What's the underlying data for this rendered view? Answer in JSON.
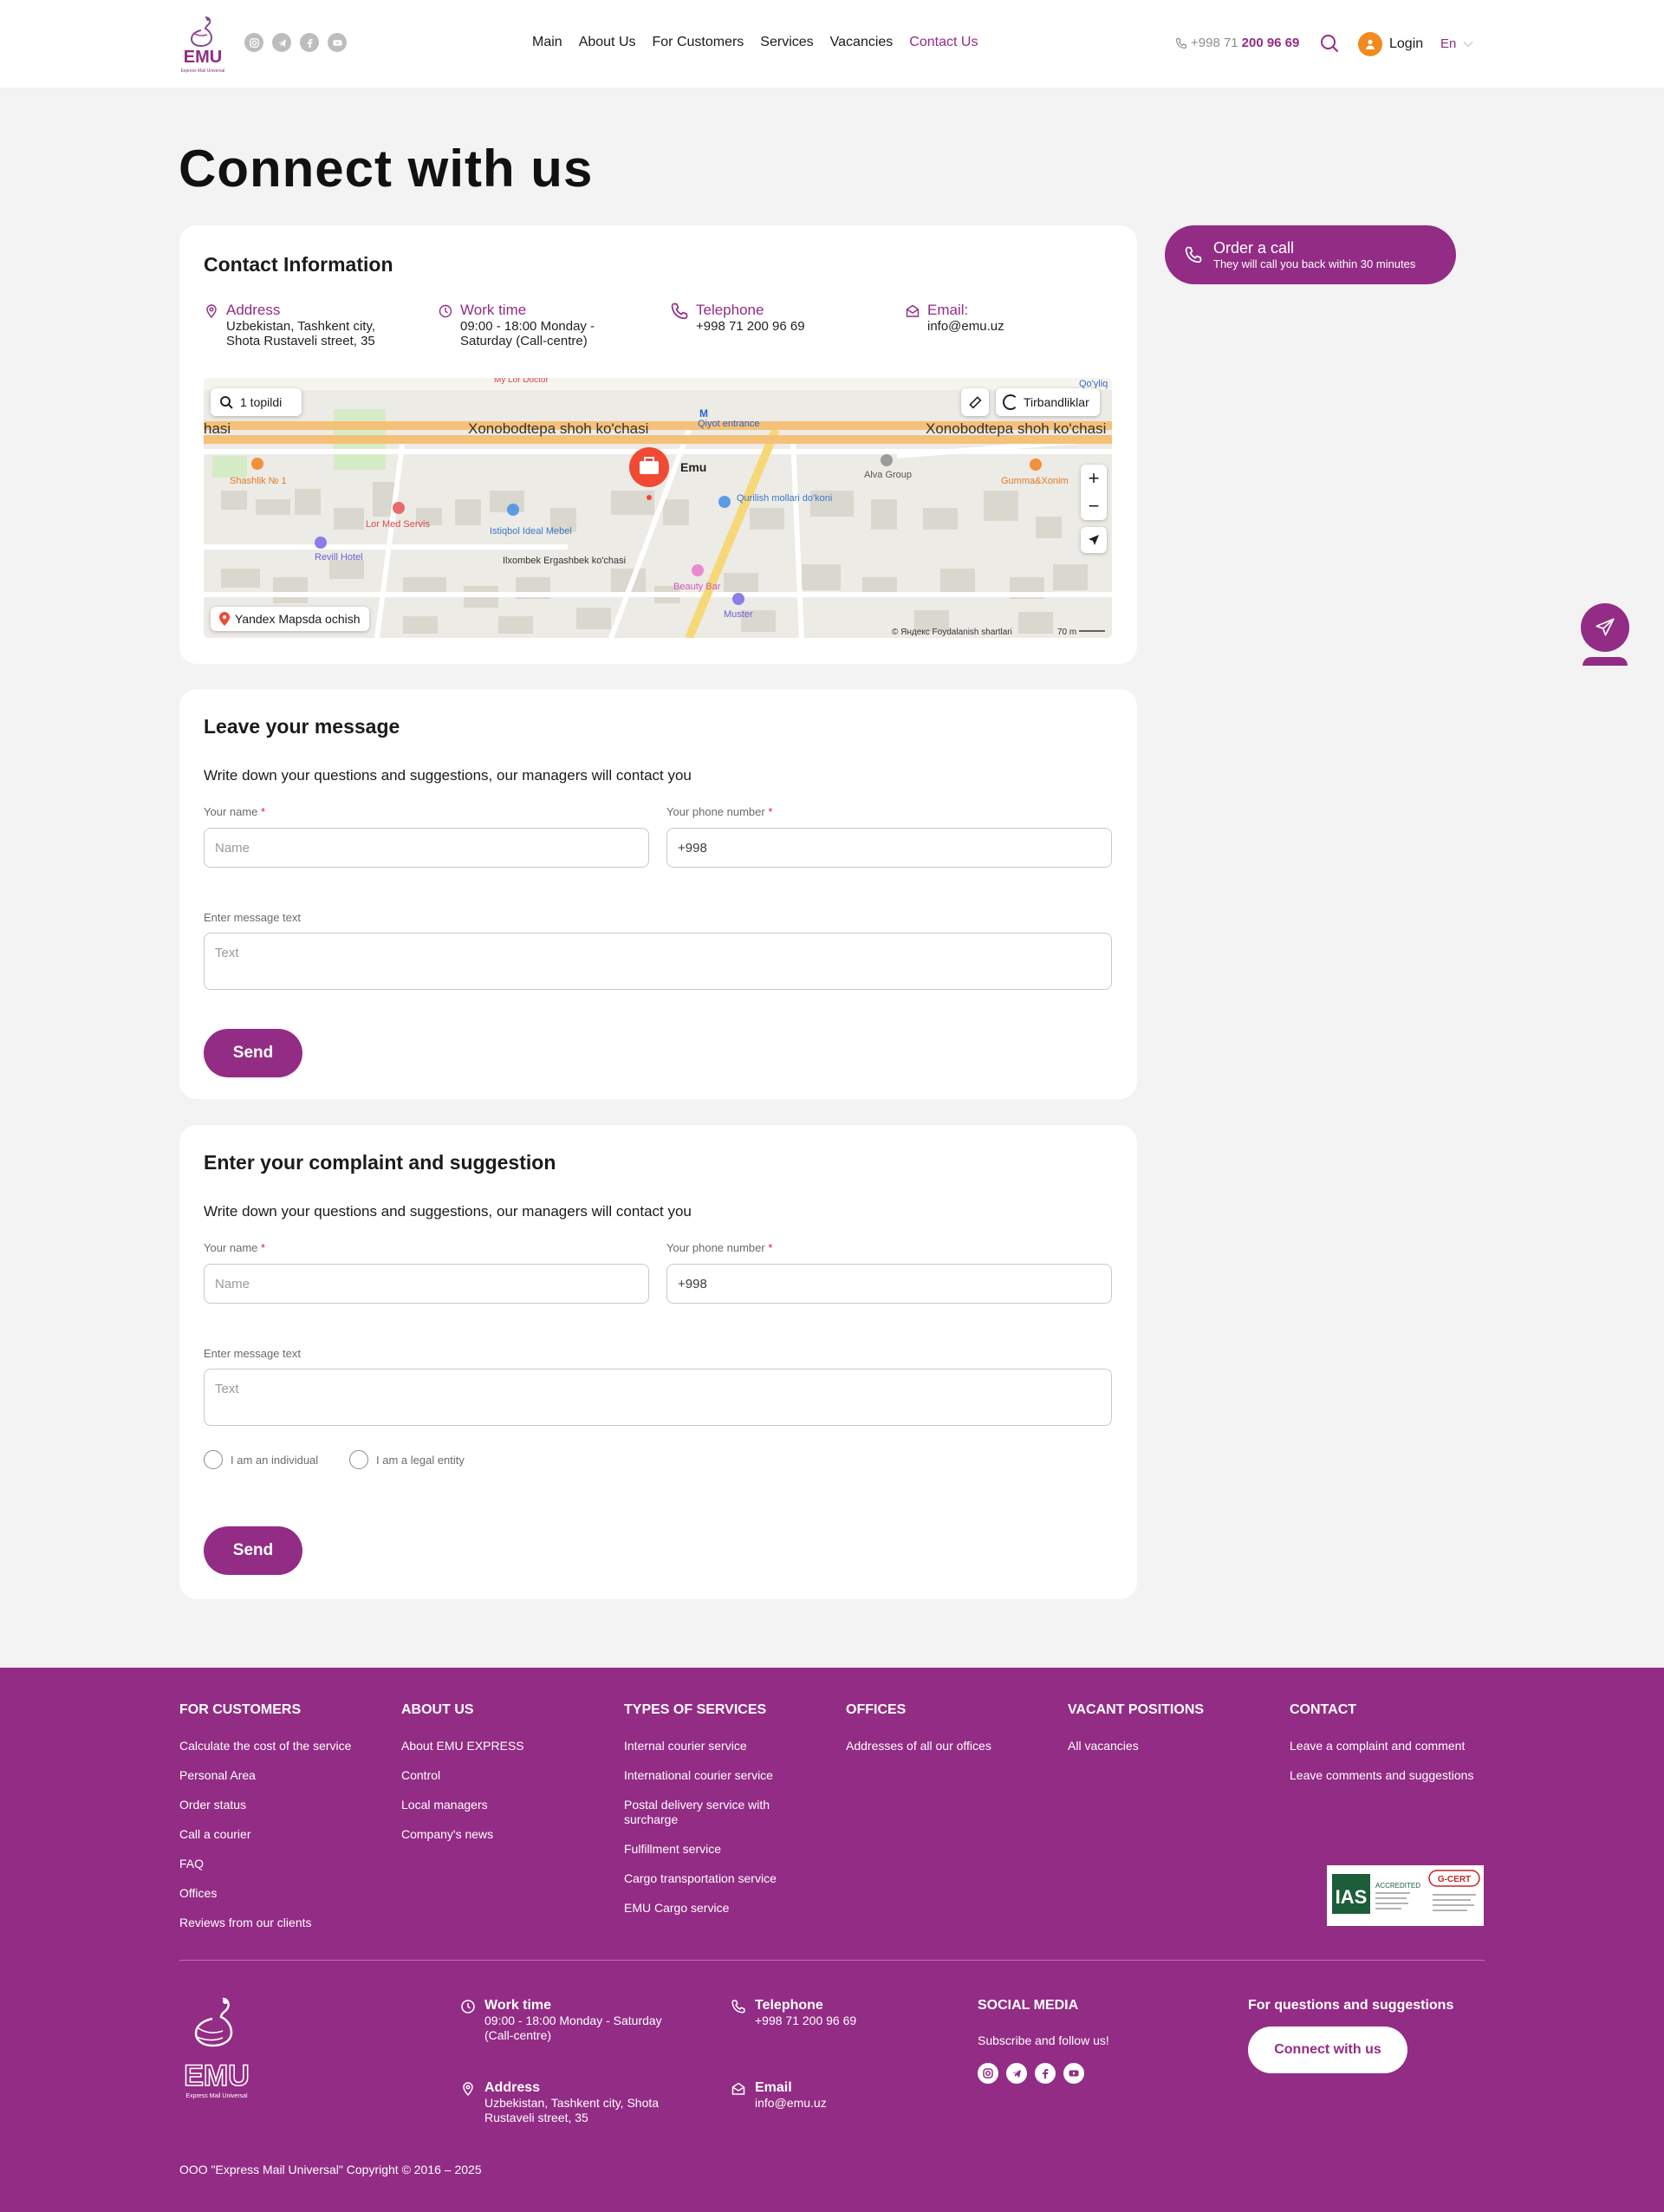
{
  "header": {
    "nav": [
      "Main",
      "About Us",
      "For Customers",
      "Services",
      "Vacancies",
      "Contact Us"
    ],
    "phone_prefix": "+998 71",
    "phone_main": "200 96 69",
    "login": "Login",
    "lang": "En"
  },
  "page_title": "Connect with us",
  "contact_card": {
    "title": "Contact Information",
    "address_label": "Address",
    "address_value": "Uzbekistan, Tashkent city, Shota Rustaveli street, 35",
    "worktime_label": "Work time",
    "worktime_value": "09:00 - 18:00 Monday - Saturday (Call-centre)",
    "telephone_label": "Telephone",
    "telephone_value": "+998 71 200 96 69",
    "email_label": "Email:",
    "email_value": "info@emu.uz"
  },
  "map": {
    "search_result": "1 topildi",
    "traffic": "Tirbandliklar",
    "street_main": "Xonobodtepa shoh ko'chasi",
    "street_left": "hasi",
    "marker": "Emu",
    "metro": "Qiyot entrance",
    "open_in": "Yandex Mapsda ochish",
    "attribution": "© Яндекс  Foydalanish shartlari",
    "scale": "70 m",
    "places": [
      "Shashlik № 1",
      "Lor Med Servis",
      "Istiqbol Ideal Mebel",
      "Revill Hotel",
      "Qurilish mollari do'koni",
      "Alva Group",
      "Gumma&Xonim",
      "Beauty Bar",
      "Muster",
      "Ilxombek Ergashbek ko'chasi",
      "My Lor Doctor",
      "Qo'yliq"
    ]
  },
  "order_call": {
    "title": "Order a call",
    "subtitle": "They will call you back within 30 minutes"
  },
  "message_form": {
    "title": "Leave your message",
    "subtitle": "Write down your questions and suggestions, our managers will contact you",
    "name_label": "Your name",
    "phone_label": "Your phone number",
    "name_placeholder": "Name",
    "phone_value": "+998",
    "message_label": "Enter message text",
    "message_placeholder": "Text",
    "send": "Send"
  },
  "complaint_form": {
    "title": "Enter your complaint and suggestion",
    "subtitle": "Write down your questions and suggestions, our managers will contact you",
    "name_label": "Your name",
    "phone_label": "Your phone number",
    "name_placeholder": "Name",
    "phone_value": "+998",
    "message_label": "Enter message text",
    "message_placeholder": "Text",
    "radio_individual": "I am an individual",
    "radio_legal": "I am a legal entity",
    "send": "Send"
  },
  "footer": {
    "columns": [
      {
        "title": "FOR CUSTOMERS",
        "links": [
          "Calculate the cost of the service",
          "Personal Area",
          "Order status",
          "Call a courier",
          "FAQ",
          "Offices",
          "Reviews from our clients"
        ]
      },
      {
        "title": "ABOUT US",
        "links": [
          "About EMU EXPRESS",
          "Control",
          "Local managers",
          "Company's news"
        ]
      },
      {
        "title": "TYPES OF SERVICES",
        "links": [
          "Internal courier service",
          "International courier service",
          "Postal delivery service with surcharge",
          "Fulfillment service",
          "Cargo transportation service",
          "EMU Cargo service"
        ]
      },
      {
        "title": "OFFICES",
        "links": [
          "Addresses of all our offices"
        ]
      },
      {
        "title": "VACANT POSITIONS",
        "links": [
          "All vacancies"
        ]
      },
      {
        "title": "CONTACT",
        "links": [
          "Leave a complaint and comment",
          "Leave comments and suggestions"
        ]
      }
    ],
    "worktime_label": "Work time",
    "worktime_value": "09:00 - 18:00 Monday - Saturday (Call-centre)",
    "telephone_label": "Telephone",
    "telephone_value": "+998 71 200 96 69",
    "address_label": "Address",
    "address_value": "Uzbekistan, Tashkent city, Shota Rustaveli street, 35",
    "email_label": "Email",
    "email_value": "info@emu.uz",
    "social_title": "SOCIAL MEDIA",
    "social_sub": "Subscribe and follow us!",
    "questions": "For questions and suggestions",
    "connect": "Connect with us",
    "copyright": "OOO \"Express Mail Universal\" Copyright © 2016 – 2025",
    "badge_ias": "IAS",
    "badge_accredited": "ACCREDITED",
    "badge_gcert": "G-CERT",
    "logo_text": "EMU",
    "logo_sub": "Express Mail Universal"
  },
  "colors": {
    "brand": "#932c85",
    "accent_orange": "#f28a1e",
    "background": "#f3f3f4"
  }
}
